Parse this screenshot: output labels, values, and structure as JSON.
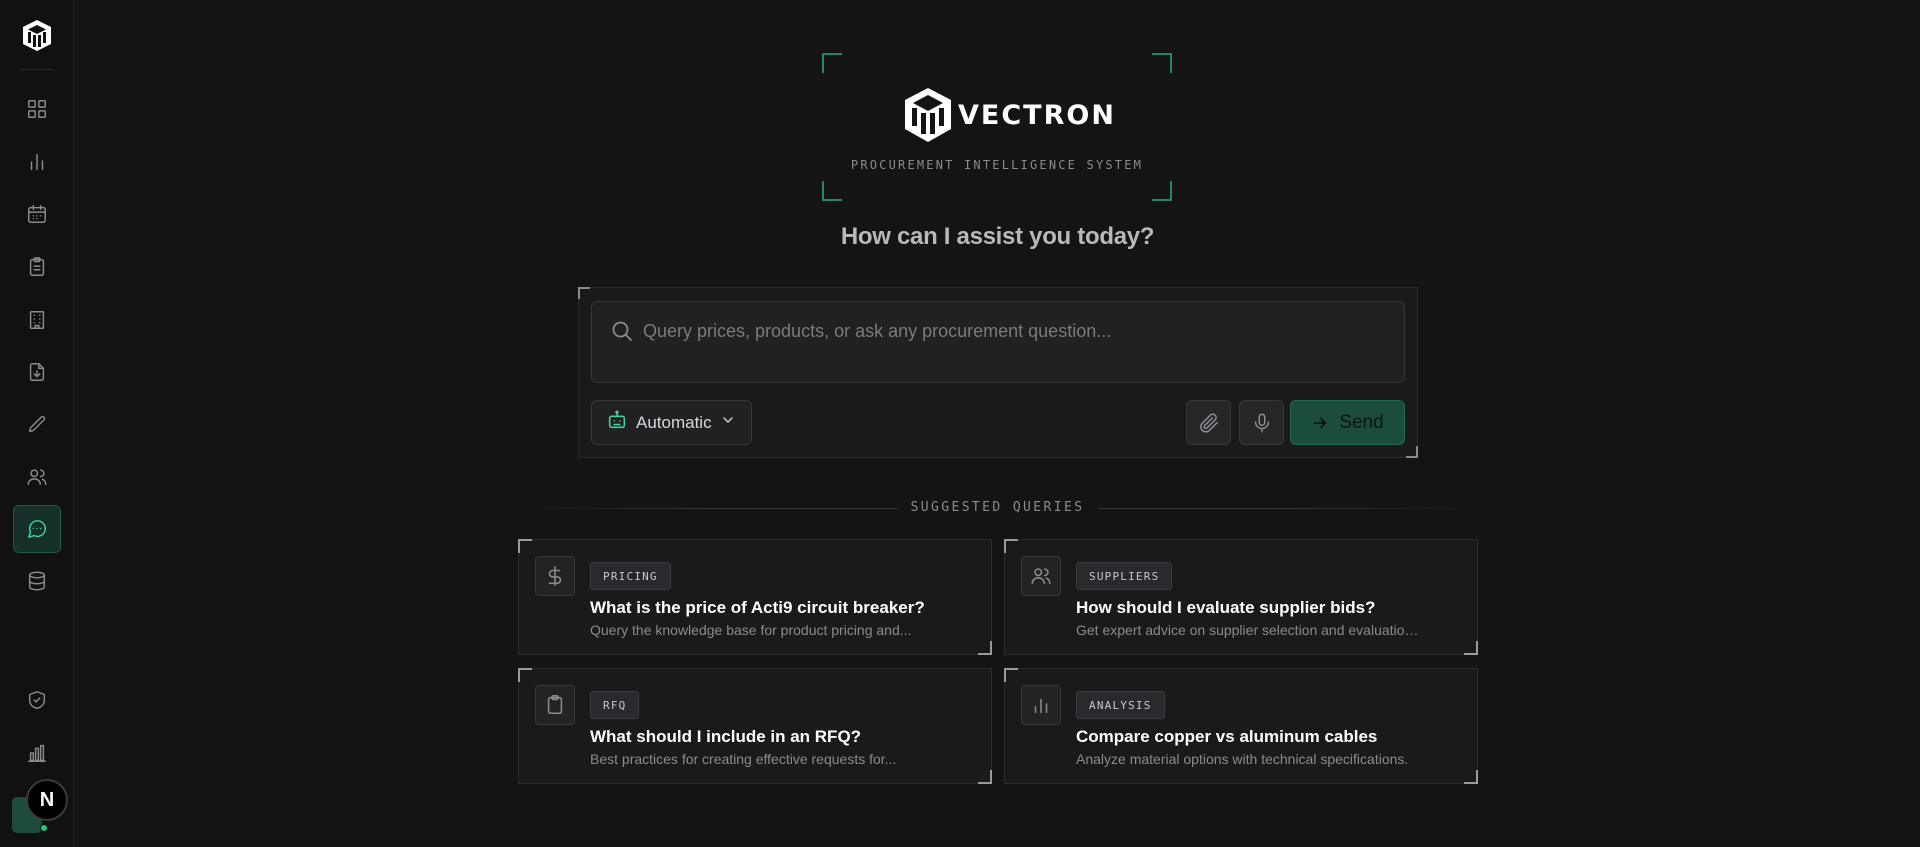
{
  "app": {
    "brand_name": "VECTRON",
    "subtitle": "PROCUREMENT INTELLIGENCE SYSTEM",
    "headline": "How can I assist you today?",
    "accent_color": "#3fd39a"
  },
  "sidebar": {
    "items": [
      {
        "icon": "dashboard-grid-icon"
      },
      {
        "icon": "bar-chart-icon"
      },
      {
        "icon": "calendar-icon"
      },
      {
        "icon": "clipboard-icon"
      },
      {
        "icon": "building-icon"
      },
      {
        "icon": "file-download-icon"
      },
      {
        "icon": "pencil-icon"
      },
      {
        "icon": "users-icon"
      },
      {
        "icon": "chat-icon",
        "active": true
      },
      {
        "icon": "database-icon"
      },
      {
        "icon": "shield-check-icon"
      },
      {
        "icon": "analytics-bars-icon"
      }
    ],
    "avatar_initial": "N"
  },
  "search": {
    "placeholder": "Query prices, products, or ask any procurement question..."
  },
  "toolbar": {
    "mode_label": "Automatic",
    "send_label": "Send"
  },
  "suggested": {
    "title": "SUGGESTED QUERIES",
    "cards": [
      {
        "tag": "PRICING",
        "icon": "dollar-icon",
        "title": "What is the price of Acti9 circuit breaker?",
        "desc": "Query the knowledge base for product pricing and..."
      },
      {
        "tag": "SUPPLIERS",
        "icon": "users-icon",
        "title": "How should I evaluate supplier bids?",
        "desc": "Get expert advice on supplier selection and evaluation..."
      },
      {
        "tag": "RFQ",
        "icon": "clipboard-icon",
        "title": "What should I include in an RFQ?",
        "desc": "Best practices for creating effective requests for..."
      },
      {
        "tag": "ANALYSIS",
        "icon": "bar-chart-icon",
        "title": "Compare copper vs aluminum cables",
        "desc": "Analyze material options with technical specifications."
      }
    ]
  }
}
